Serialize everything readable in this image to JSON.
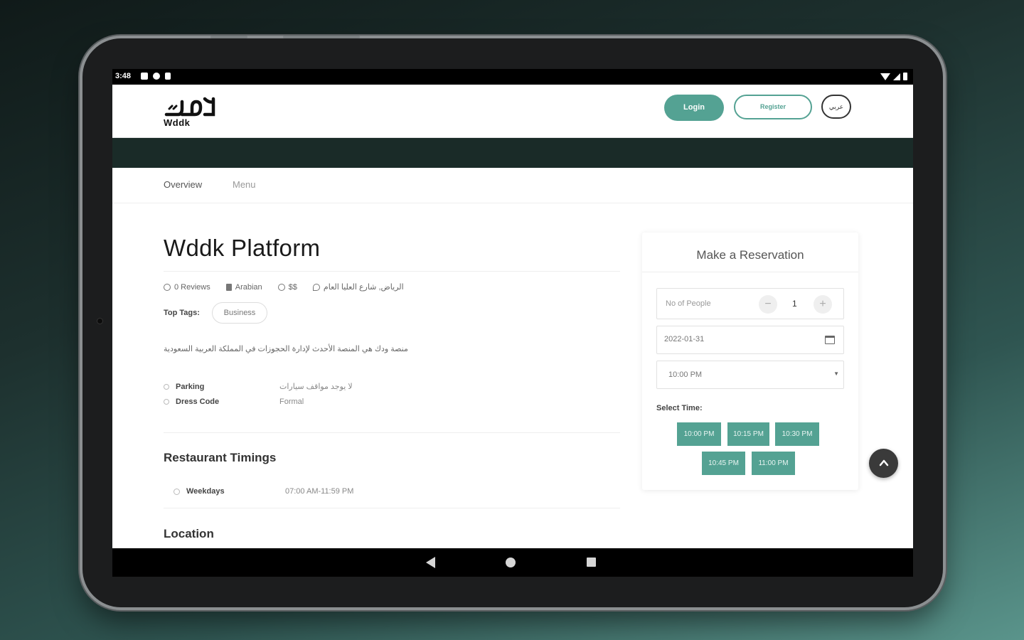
{
  "status_bar": {
    "time": "3:48"
  },
  "header": {
    "logo_text": "Wddk",
    "login_label": "Login",
    "register_label": "Register",
    "lang_label": "عربي"
  },
  "tabs": [
    {
      "label": "Overview"
    },
    {
      "label": "Menu"
    }
  ],
  "restaurant": {
    "title": "Wddk Platform",
    "reviews": "0 Reviews",
    "cuisine": "Arabian",
    "price": "$$",
    "location": "الرياض, شارع العليا العام",
    "top_tags_label": "Top Tags:",
    "tags": [
      "Business"
    ],
    "description": "منصة ودك هي المنصة الأحدث لإدارة الحجوزات في المملكة العربية السعودية",
    "info": [
      {
        "label": "Parking",
        "value": "لا يوجد مواقف سيارات"
      },
      {
        "label": "Dress Code",
        "value": "Formal"
      }
    ],
    "timings_title": "Restaurant Timings",
    "timings": [
      {
        "label": "Weekdays",
        "value": "07:00 AM-11:59 PM"
      }
    ],
    "location_title": "Location"
  },
  "reservation": {
    "title": "Make a Reservation",
    "people_placeholder": "No of People",
    "people_count": "1",
    "minus": "−",
    "plus": "+",
    "date": "2022-01-31",
    "time": "10:00 PM",
    "select_time_label": "Select Time:",
    "slots": [
      "10:00 PM",
      "10:15 PM",
      "10:30 PM",
      "10:45 PM",
      "11:00 PM"
    ]
  },
  "scroll_top_icon": "chevron-up-icon",
  "colors": {
    "accent": "#54a293",
    "dark_band": "#1a2b28"
  }
}
